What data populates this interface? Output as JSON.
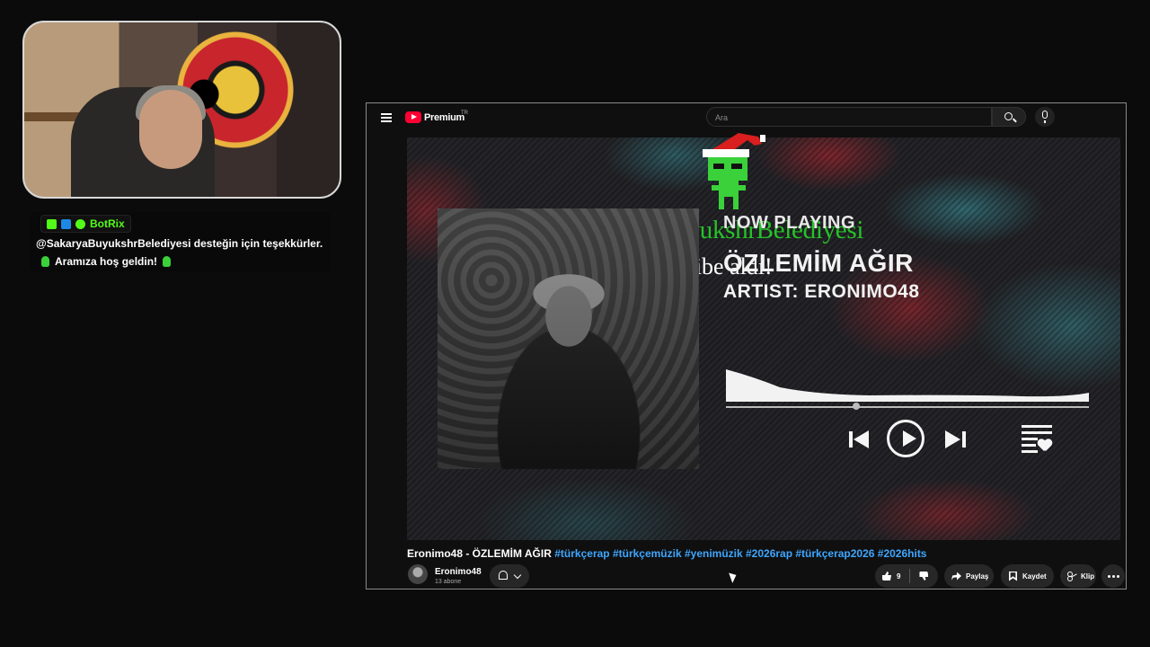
{
  "chat": {
    "bot_name": "BotRix",
    "message_line1": "@SakaryaBuyukshrBelediyesi desteğin için teşekkürler.",
    "message_line2": "Aramıza hoş geldin!"
  },
  "youtube": {
    "brand": "Premium",
    "brand_region": "TR",
    "search_placeholder": "Ara",
    "player": {
      "now_playing_label": "NOW PLAYING",
      "song_title": "ÖZLEMİM AĞIR",
      "artist_line": "ARTIST: ERONIMO48",
      "progress": 0.36
    },
    "video": {
      "title": "Eronimo48 - ÖZLEMİM AĞIR",
      "hashtags": "#türkçerap #türkçemüzik #yenimüzik #2026rap #türkçerap2026 #2026hits",
      "channel_name": "Eronimo48",
      "subscribers": "13 abone",
      "like_count": "9",
      "share_label": "Paylaş",
      "save_label": "Kaydet",
      "clip_label": "Klip"
    }
  },
  "overlay": {
    "alert_name": "SakaryaBuyukshrBelediyesi",
    "alert_text": "takibe aldı!"
  },
  "colors": {
    "kick_green": "#53fc18",
    "youtube_red": "#ff0033",
    "hashtag_blue": "#3ea6ff",
    "alert_green": "#27d42a"
  }
}
